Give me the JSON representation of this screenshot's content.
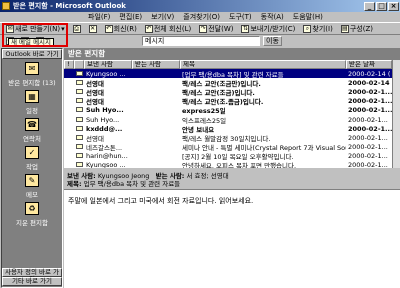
{
  "window": {
    "title": "받은 편지함 - Microsoft Outlook"
  },
  "menu": [
    "파일(F)",
    "편집(E)",
    "보기(V)",
    "즐겨찾기(O)",
    "도구(T)",
    "동작(A)",
    "도움말(H)"
  ],
  "toolbar1": [
    {
      "label": "새로 만들기(N)",
      "icon": "new-mail-icon"
    },
    {
      "label": "",
      "icon": "print-icon"
    },
    {
      "label": "",
      "icon": "delete-icon"
    },
    {
      "label": "회신(R)",
      "icon": "reply-icon"
    },
    {
      "label": "전체 회신(L)",
      "icon": "reply-all-icon"
    },
    {
      "label": "전달(W)",
      "icon": "forward-icon"
    },
    {
      "label": "보내기/받기(C)",
      "icon": "send-receive-icon"
    },
    {
      "label": "찾기(I)",
      "icon": "find-icon"
    },
    {
      "label": "구성(Z)",
      "icon": "organize-icon"
    }
  ],
  "toolbar2": {
    "address": "메시지",
    "go_label": "이동"
  },
  "tooltip": "새 메일 메시지",
  "outlook_bar": {
    "header": "Outlook 바로 가기",
    "items": [
      {
        "label": "받은 편지함 (13)",
        "icon": "inbox-icon"
      },
      {
        "label": "일정",
        "icon": "calendar-icon"
      },
      {
        "label": "연락처",
        "icon": "contacts-icon"
      },
      {
        "label": "작업",
        "icon": "tasks-icon"
      },
      {
        "label": "메모",
        "icon": "notes-icon"
      },
      {
        "label": "지운 편지함",
        "icon": "deleted-items-icon"
      }
    ],
    "footer1": "사용자 정의 바로 가기",
    "footer2": "기타 바로 가기"
  },
  "folder": {
    "title": "받은 편지함"
  },
  "columns": [
    "!",
    "보낸 사람",
    "받는 사람",
    "제목",
    "받은 날짜"
  ],
  "messages": [
    {
      "from": "Kyungsoo ...",
      "subject": "[업무 팩/용dba 목차] 및 관련 자료들",
      "date": "2000-02-14 (",
      "selected": true,
      "unread": false
    },
    {
      "from": "선영대",
      "subject": "팩/레스 교안(조금만)입니다.",
      "date": "2000-02-14 (",
      "selected": false,
      "unread": true
    },
    {
      "from": "선영대",
      "subject": "팩/레스 교안(조금)입니다.",
      "date": "2000-02-1...",
      "selected": false,
      "unread": true
    },
    {
      "from": "선영대",
      "subject": "팩/레스 교안(조.좀금)입니다.",
      "date": "2000-02-1...",
      "selected": false,
      "unread": true
    },
    {
      "from": "Suh Hyo...",
      "subject": "express25일",
      "date": "2000-02-1...",
      "selected": false,
      "unread": true
    },
    {
      "from": "Suh Hyo...",
      "subject": "익스프레스25일",
      "date": "2000-02-1...",
      "selected": false,
      "unread": false
    },
    {
      "from": "kxddd@...",
      "subject": "안녕 보내요",
      "date": "2000-02-1...",
      "selected": false,
      "unread": true
    },
    {
      "from": "선영대",
      "subject": "팩/레스 월말감정 30일치입니다.",
      "date": "2000-02-1...",
      "selected": false,
      "unread": false
    },
    {
      "from": "네즈갈스톤...",
      "subject": "세미나 안내 - 특별 세미나(Crystal Report 7과 Visual SourceS...",
      "date": "2000-02-1...",
      "selected": false,
      "unread": false
    },
    {
      "from": "harin@hun...",
      "subject": "[공지] 2월 10일 목요일 오후활약입니다.",
      "date": "2000-02-1...",
      "selected": false,
      "unread": false
    },
    {
      "from": "Kyungsoo ...",
      "subject": "안녕하세요. 오피스 목차 포면 만했습니다.",
      "date": "2000-02-1...",
      "selected": false,
      "unread": false
    }
  ],
  "preview": {
    "from_label": "보낸 사람:",
    "from_value": "Kyungsoo Jeong",
    "to_label": "받는 사람:",
    "to_value": "서 효정; 선영대",
    "subject_label": "제목:",
    "subject_value": "업무 팩/용dba 목차 및 관련 자료들",
    "body": "주말에 일본에서 그리고 미국에서 회전 자료입니다. 읽어보세요."
  },
  "colors": {
    "title_start": "#0a246a",
    "title_end": "#a6caf0",
    "highlight": "#e00000",
    "selection": "#000080"
  }
}
